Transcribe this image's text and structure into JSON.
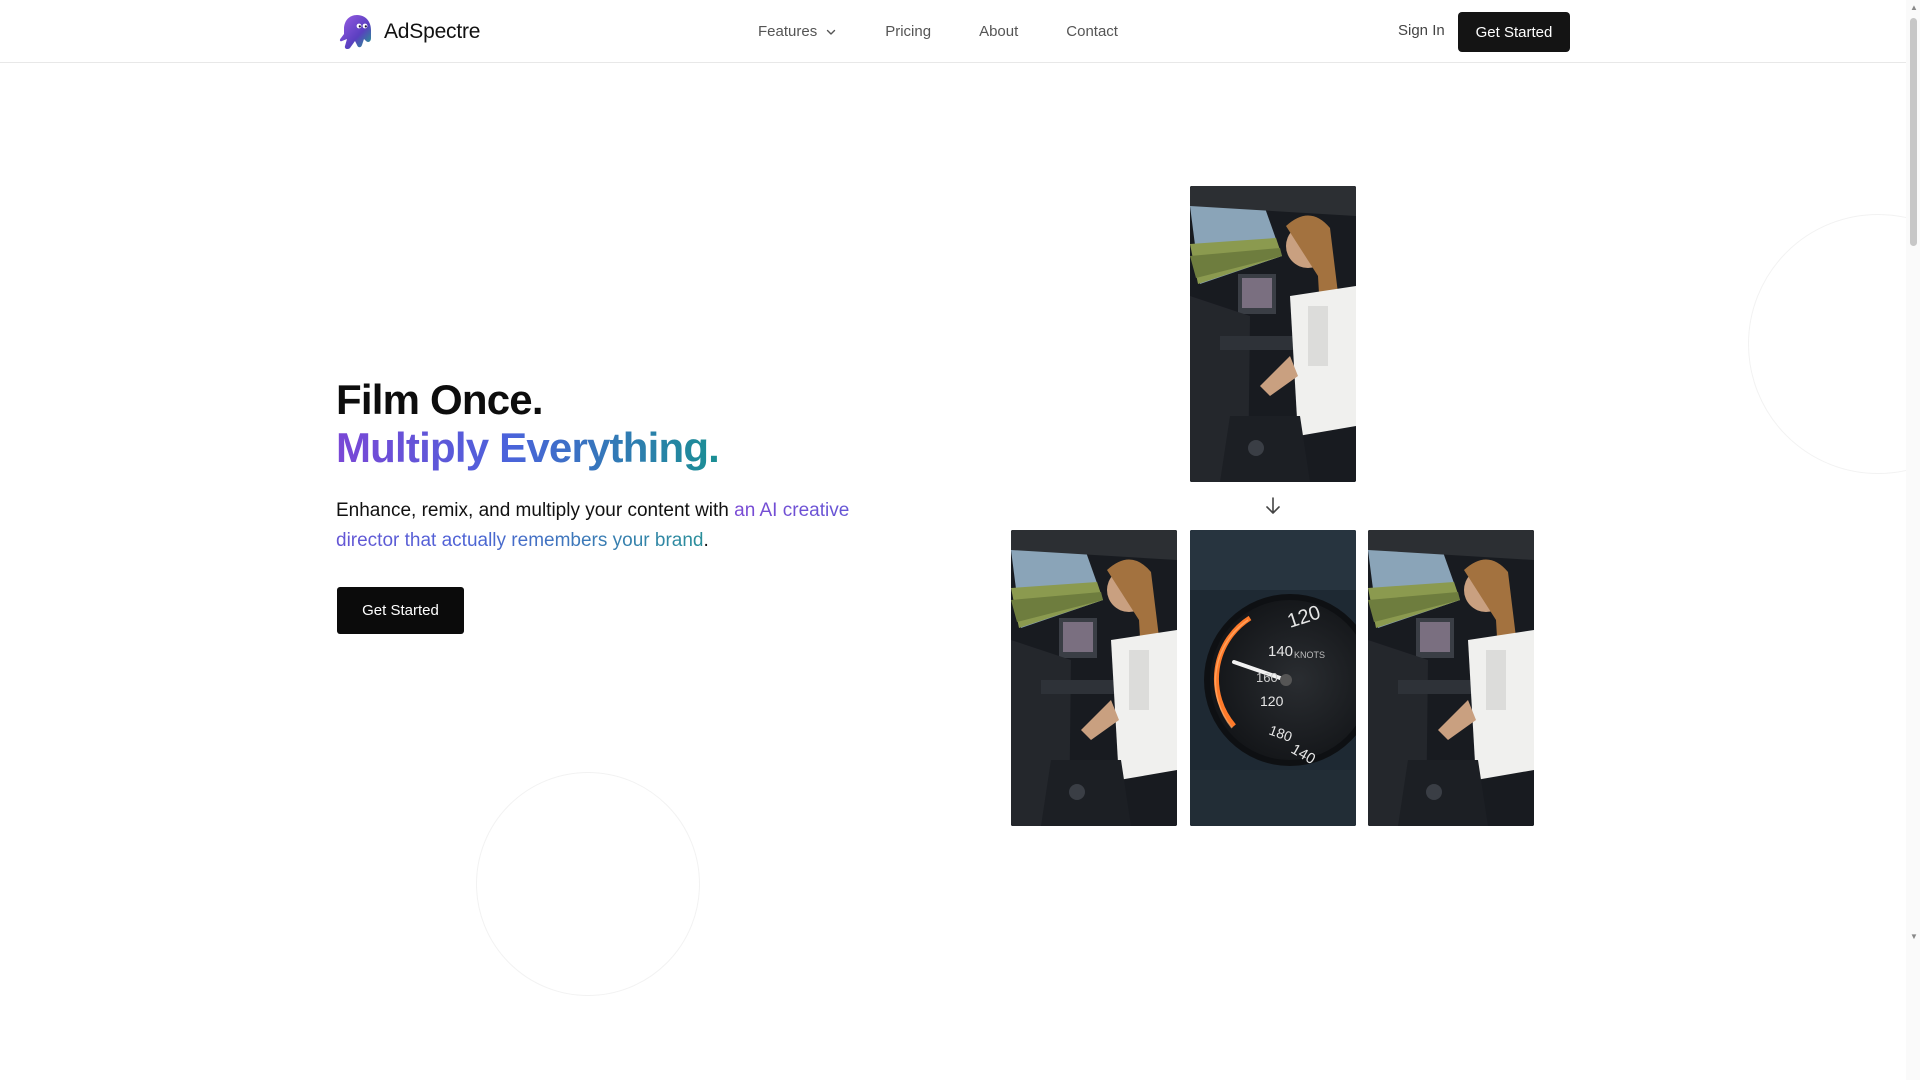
{
  "brand": {
    "name": "AdSpectre",
    "logo_icon": "ghost-logo-icon"
  },
  "nav": {
    "items": [
      {
        "label": "Features",
        "has_dropdown": true
      },
      {
        "label": "Pricing"
      },
      {
        "label": "About"
      },
      {
        "label": "Contact"
      }
    ]
  },
  "header": {
    "sign_in_label": "Sign In",
    "cta_label": "Get Started"
  },
  "hero": {
    "title_line1": "Film Once.",
    "title_line2": "Multiply Everything.",
    "subtitle_plain": "Enhance, remix, and multiply your content with ",
    "subtitle_highlight": "an AI creative director that actually remembers your brand",
    "subtitle_end": ".",
    "cta_label": "Get Started"
  },
  "showcase": {
    "source_frame": "pilot-cockpit-video",
    "arrow_icon": "arrow-down-icon",
    "output_frames": [
      "pilot-cockpit-video",
      "airspeed-gauge-video",
      "pilot-cockpit-video"
    ],
    "gauge_numbers": [
      "120",
      "140",
      "160",
      "120",
      "180",
      "140"
    ],
    "gauge_unit": "KNOTS"
  },
  "colors": {
    "accent_start": "#7a47d6",
    "accent_mid": "#4b63db",
    "accent_end": "#1a8f93",
    "button_bg": "#0b0b0b"
  }
}
